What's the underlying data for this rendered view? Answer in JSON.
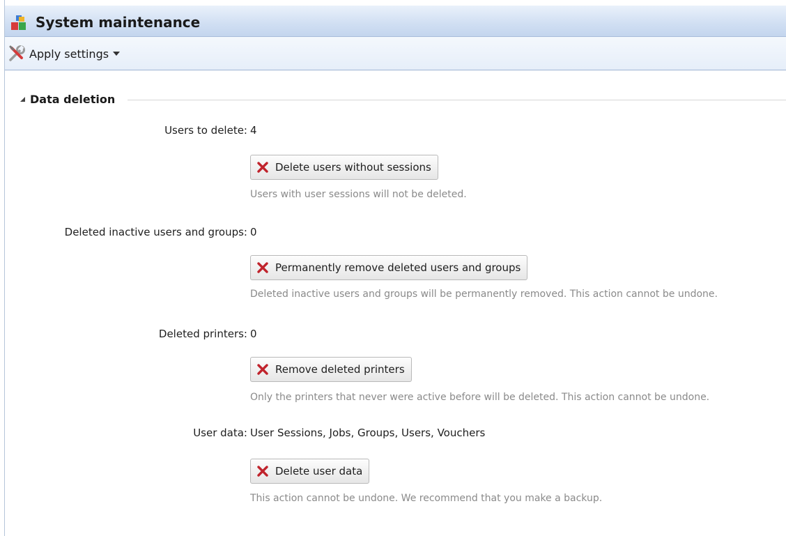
{
  "window": {
    "title": "System maintenance",
    "icon": "blocks-app-icon"
  },
  "toolbar": {
    "apply_label": "Apply settings",
    "apply_icon": "wrench-screwdriver-icon"
  },
  "section": {
    "title": "Data deletion"
  },
  "rows": [
    {
      "label": "Users to delete:",
      "value": "4",
      "button": "Delete users without sessions",
      "hint": "Users with user sessions will not be deleted."
    },
    {
      "label": "Deleted inactive users and groups:",
      "value": "0",
      "button": "Permanently remove deleted users and groups",
      "hint": "Deleted inactive users and groups will be permanently removed. This action cannot be undone."
    },
    {
      "label": "Deleted printers:",
      "value": "0",
      "button": "Remove deleted printers",
      "hint": "Only the printers that never were active before will be deleted. This action cannot be undone."
    },
    {
      "label": "User data:",
      "value": "User Sessions, Jobs, Groups, Users, Vouchers",
      "button": "Delete user data",
      "hint": "This action cannot be undone. We recommend that you make a backup."
    }
  ],
  "colors": {
    "delete_icon": "#c0232c",
    "hint_text": "#8a8a8a",
    "header_blue": "#d2e0f3"
  }
}
